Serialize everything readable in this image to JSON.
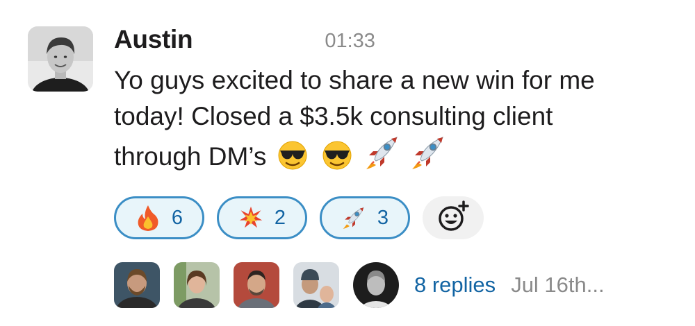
{
  "message": {
    "author": "Austin",
    "timestamp": "01:33",
    "text_line1": "Yo guys excited to share a new win for me",
    "text_line2": "today! Closed a $3.5k consulting client",
    "text_line3": "through DM’s",
    "inline_emojis": [
      "sunglasses-emoji",
      "sunglasses-emoji",
      "rocket-emoji",
      "rocket-emoji"
    ]
  },
  "reactions": [
    {
      "emoji": "fire-emoji",
      "count": "6"
    },
    {
      "emoji": "collision-emoji",
      "count": "2"
    },
    {
      "emoji": "rocket-emoji",
      "count": "3"
    }
  ],
  "add_reaction_icon": "add-reaction-icon",
  "thread": {
    "participant_count": 5,
    "replies_label": "8 replies",
    "last_reply": "Jul 16th..."
  },
  "colors": {
    "reaction_border": "#3b8ec5",
    "reaction_bg": "#e8f5fa",
    "link": "#1264a3",
    "muted": "#8a8a8a"
  }
}
